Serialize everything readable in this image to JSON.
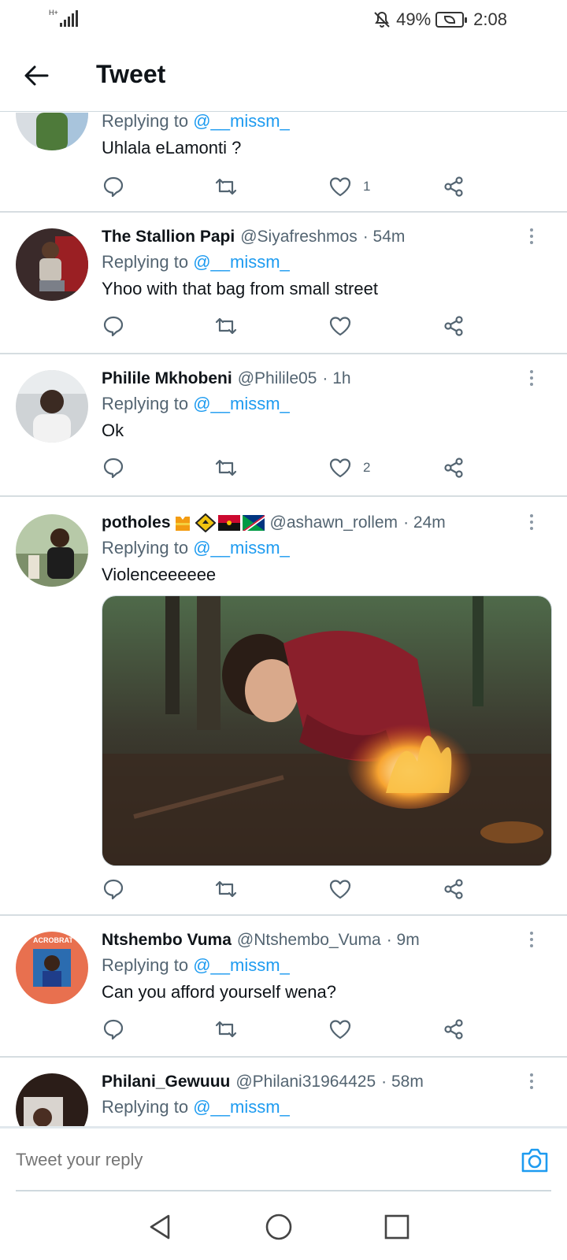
{
  "status_bar": {
    "network": "H+",
    "battery_percent": "49%",
    "time": "2:08",
    "icons": [
      "signal-icon",
      "mute-icon",
      "battery-icon"
    ]
  },
  "header": {
    "title": "Tweet",
    "back_icon": "arrow-left-icon"
  },
  "tweets": [
    {
      "replying_prefix": "Replying to",
      "mention": "@__missm_",
      "text": "Uhlala eLamonti ?",
      "likes": "1"
    },
    {
      "name": "The Stallion Papi",
      "handle": "@Siyafreshmos",
      "time": "· 54m",
      "replying_prefix": "Replying to",
      "mention": "@__missm_",
      "text": "Yhoo with that bag from small street",
      "likes": ""
    },
    {
      "name": "Philile Mkhobeni",
      "handle": "@Philile05",
      "time": "· 1h",
      "replying_prefix": "Replying to",
      "mention": "@__missm_",
      "text": "Ok",
      "likes": "2"
    },
    {
      "name": "potholes",
      "name_emojis": [
        "construction-vest-emoji",
        "road-sign-emoji",
        "angola-flag-emoji",
        "namibia-flag-emoji"
      ],
      "handle": "@ashawn_rollem",
      "time": "· 24m",
      "replying_prefix": "Replying to",
      "mention": "@__missm_",
      "text": "Violenceeeeee",
      "likes": "",
      "has_image": true
    },
    {
      "name": "Ntshembo Vuma",
      "handle": "@Ntshembo_Vuma",
      "time": "· 9m",
      "replying_prefix": "Replying to",
      "mention": "@__missm_",
      "text": "Can you afford yourself wena?",
      "likes": "",
      "avatar_text": "ACROBRAT"
    },
    {
      "name": "Philani_Gewuuu",
      "handle": "@Philani31964425",
      "time": "· 58m",
      "replying_prefix": "Replying to",
      "mention": "@__missm_"
    }
  ],
  "reply_bar": {
    "placeholder": "Tweet your reply",
    "camera_icon": "camera-icon"
  },
  "nav_bar": {
    "icons": [
      "back-triangle-icon",
      "home-circle-icon",
      "recents-square-icon"
    ]
  },
  "colors": {
    "accent": "#1d9bf0",
    "secondary_text": "#536471",
    "divider": "#d6dde1"
  }
}
